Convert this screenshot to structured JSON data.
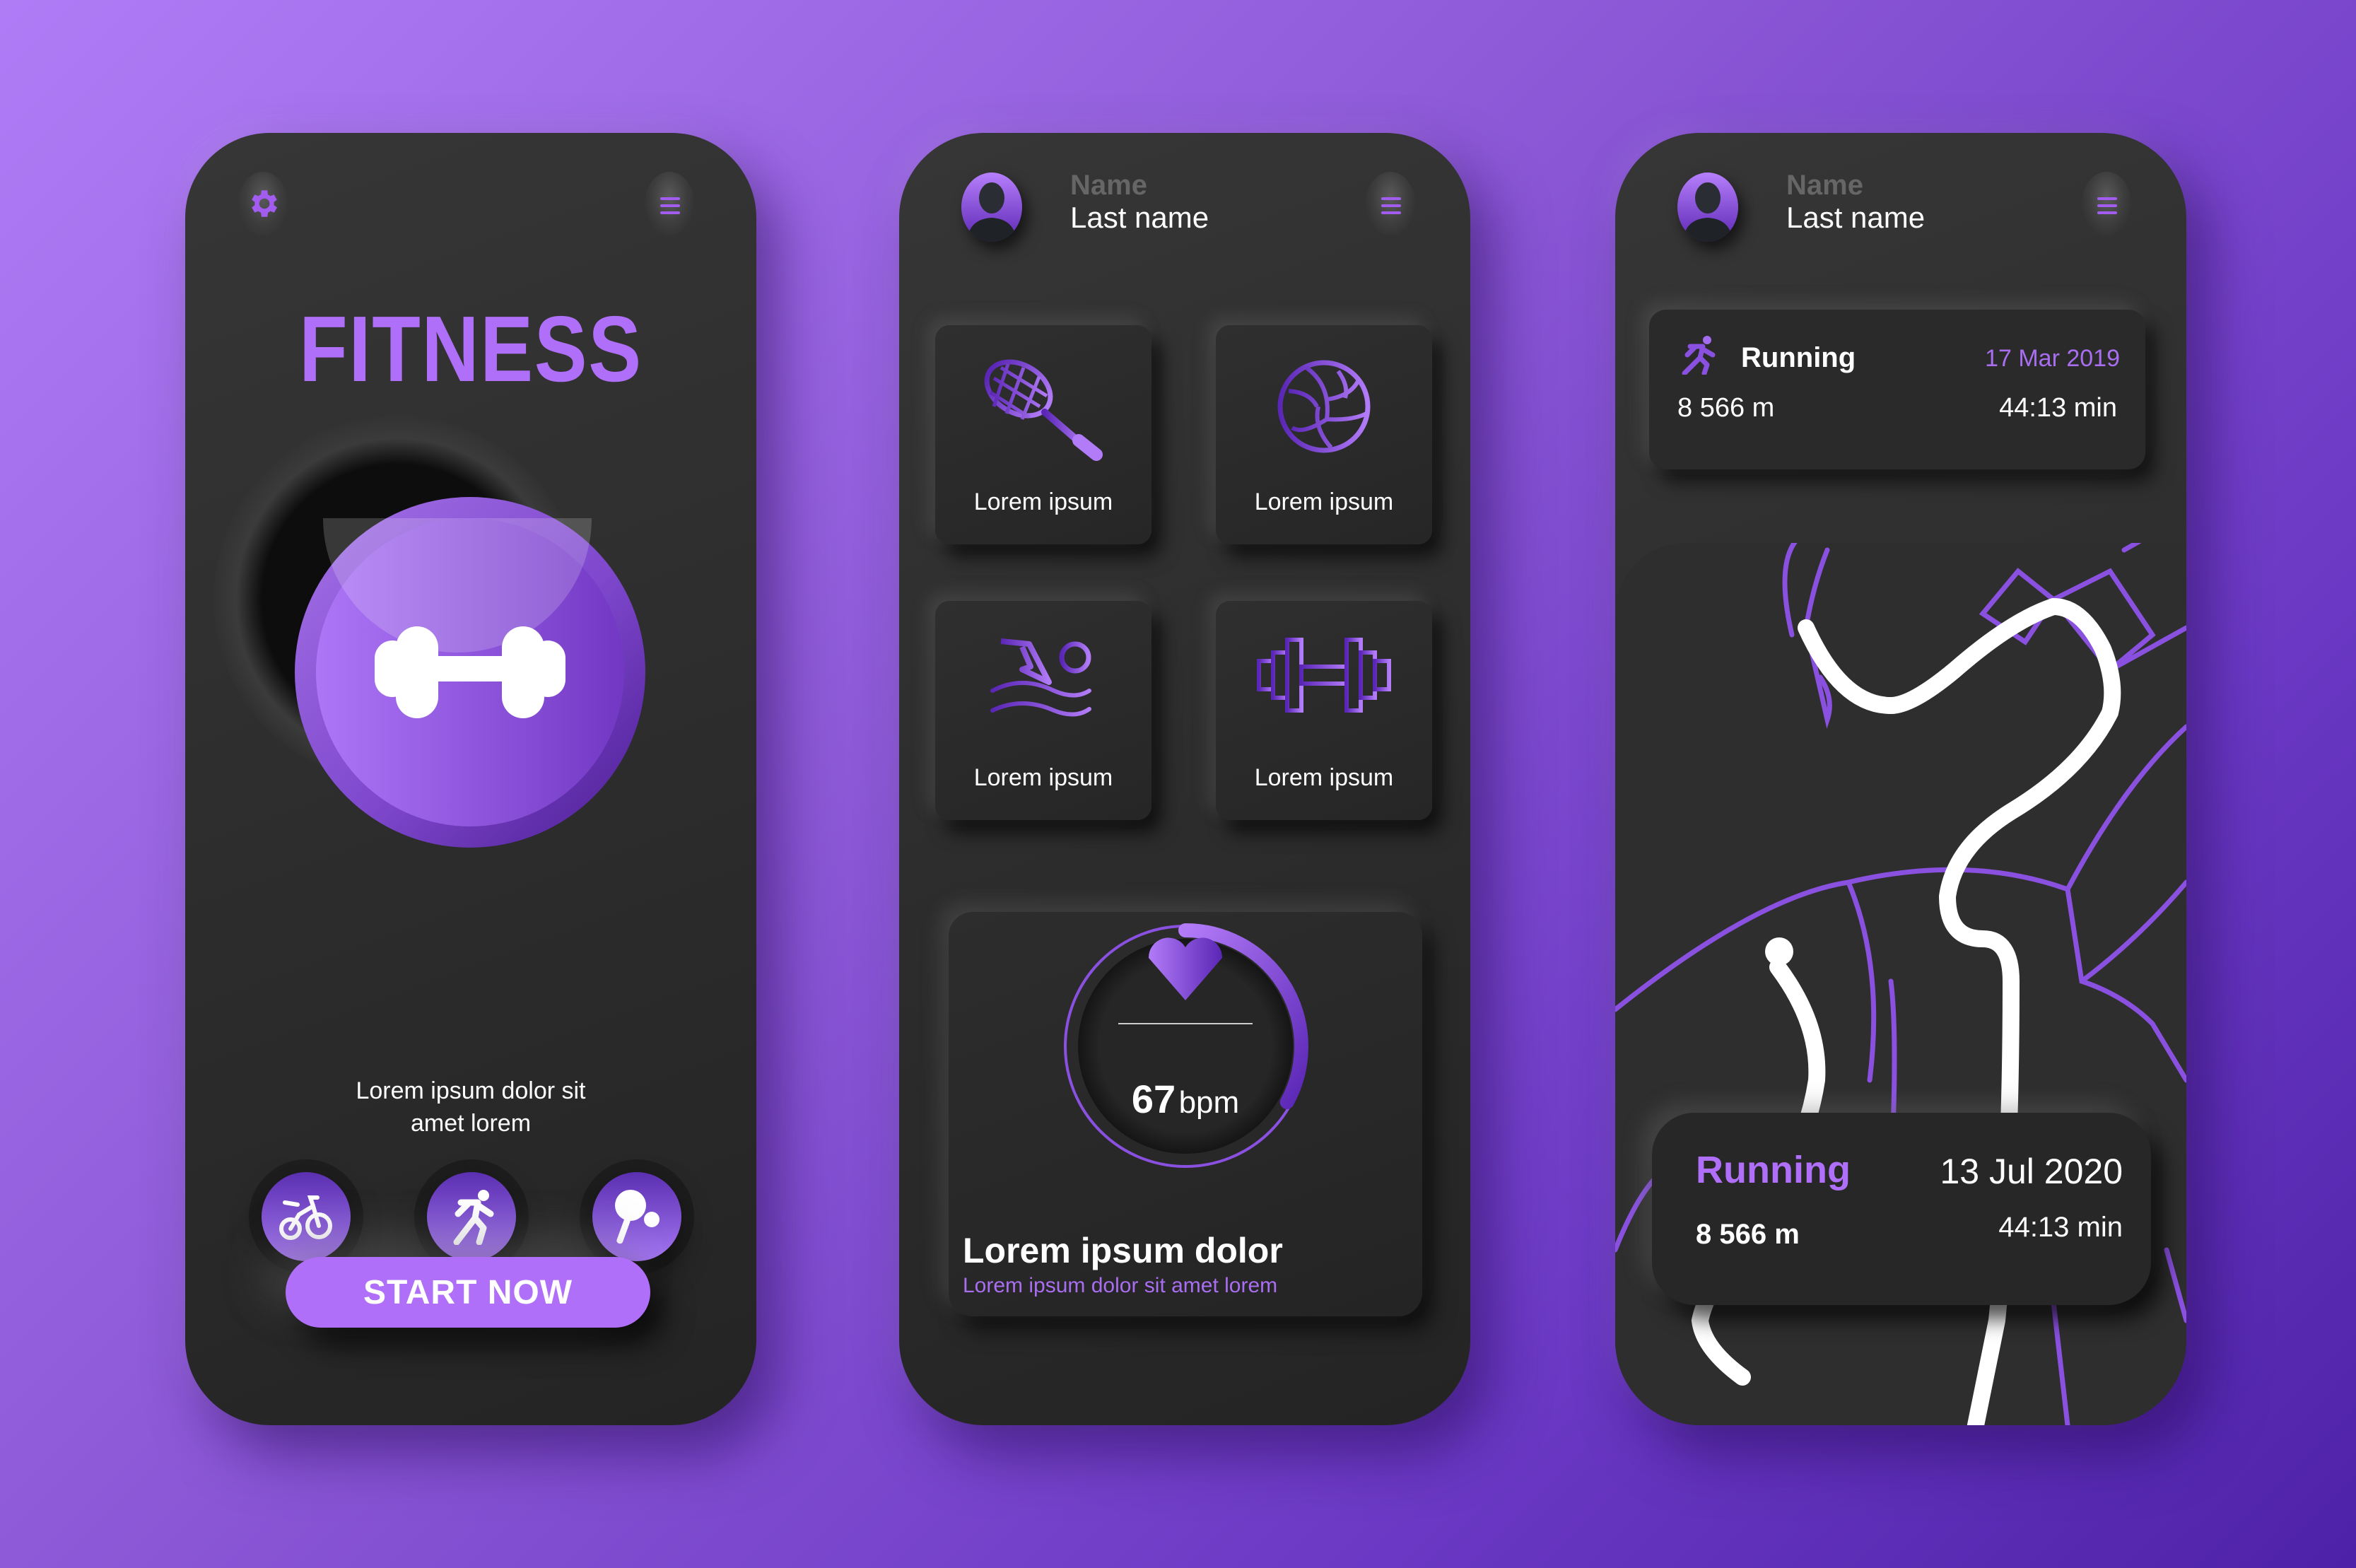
{
  "accent_color": "#b06ff9",
  "screen1": {
    "settings_icon": "gear-icon",
    "menu_icon": "hamburger-menu-icon",
    "title": "FITNESS",
    "hero_icon": "dumbbell-icon",
    "description_line1": "Lorem ipsum dolor sit",
    "description_line2": "amet lorem",
    "sport_buttons": [
      {
        "icon": "bicycle-icon"
      },
      {
        "icon": "running-icon"
      },
      {
        "icon": "ping-pong-icon"
      }
    ],
    "start_label": "START NOW"
  },
  "screen2": {
    "user": {
      "name": "Name",
      "last_name": "Last name"
    },
    "menu_icon": "hamburger-menu-icon",
    "tiles": [
      {
        "icon": "tennis-racket-icon",
        "label": "Lorem ipsum"
      },
      {
        "icon": "volleyball-icon",
        "label": "Lorem ipsum"
      },
      {
        "icon": "swimming-icon",
        "label": "Lorem ipsum"
      },
      {
        "icon": "dumbbell-icon",
        "label": "Lorem ipsum"
      }
    ],
    "heart_rate": {
      "value": "67",
      "unit": "bpm",
      "progress_fraction": 0.33,
      "title": "Lorem ipsum dolor",
      "subtitle": "Lorem ipsum dolor sit amet lorem"
    }
  },
  "screen3": {
    "user": {
      "name": "Name",
      "last_name": "Last name"
    },
    "menu_icon": "hamburger-menu-icon",
    "activity_card": {
      "activity": "Running",
      "date": "17 Mar 2019",
      "distance": "8 566 m",
      "duration": "44:13 min"
    },
    "route_card": {
      "activity": "Running",
      "date": "13 Jul 2020",
      "distance": "8 566 m",
      "duration": "44:13 min"
    }
  }
}
